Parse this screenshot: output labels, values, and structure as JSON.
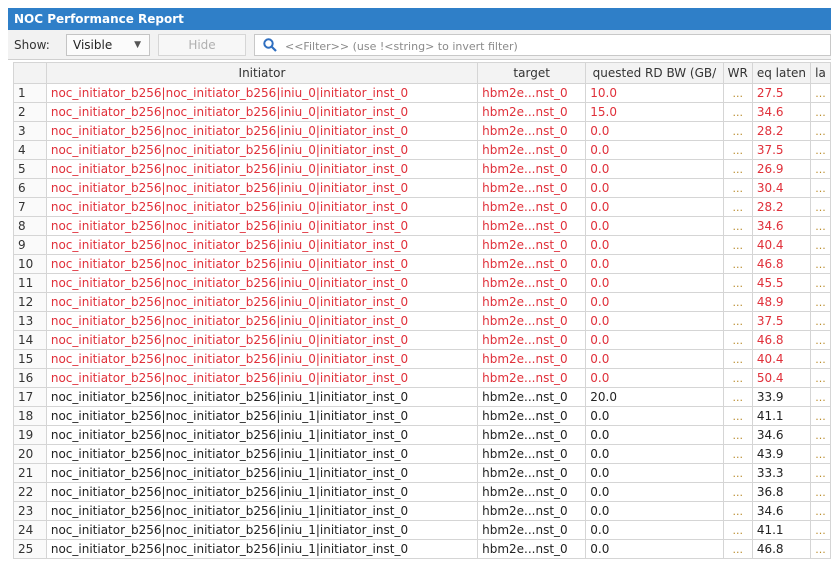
{
  "window": {
    "title": "NOC Performance Report"
  },
  "toolbar": {
    "show_label": "Show:",
    "show_value": "Visible",
    "hide_label": "Hide",
    "filter_placeholder": "<<Filter>> (use !<string> to invert filter)"
  },
  "table": {
    "columns": [
      "",
      "Initiator",
      "target",
      "quested RD BW (GB/",
      "WR",
      "eq laten",
      "la"
    ],
    "rows": [
      {
        "n": "1",
        "initiator": "noc_initiator_b256|noc_initiator_b256|iniu_0|initiator_inst_0",
        "target": "hbm2e...nst_0",
        "rd_bw": "10.0",
        "wr": "...",
        "lat": "27.5",
        "la": "...",
        "highlight": true
      },
      {
        "n": "2",
        "initiator": "noc_initiator_b256|noc_initiator_b256|iniu_0|initiator_inst_0",
        "target": "hbm2e...nst_0",
        "rd_bw": "15.0",
        "wr": "...",
        "lat": "34.6",
        "la": "...",
        "highlight": true
      },
      {
        "n": "3",
        "initiator": "noc_initiator_b256|noc_initiator_b256|iniu_0|initiator_inst_0",
        "target": "hbm2e...nst_0",
        "rd_bw": "0.0",
        "wr": "...",
        "lat": "28.2",
        "la": "...",
        "highlight": true
      },
      {
        "n": "4",
        "initiator": "noc_initiator_b256|noc_initiator_b256|iniu_0|initiator_inst_0",
        "target": "hbm2e...nst_0",
        "rd_bw": "0.0",
        "wr": "...",
        "lat": "37.5",
        "la": "...",
        "highlight": true
      },
      {
        "n": "5",
        "initiator": "noc_initiator_b256|noc_initiator_b256|iniu_0|initiator_inst_0",
        "target": "hbm2e...nst_0",
        "rd_bw": "0.0",
        "wr": "...",
        "lat": "26.9",
        "la": "...",
        "highlight": true
      },
      {
        "n": "6",
        "initiator": "noc_initiator_b256|noc_initiator_b256|iniu_0|initiator_inst_0",
        "target": "hbm2e...nst_0",
        "rd_bw": "0.0",
        "wr": "...",
        "lat": "30.4",
        "la": "...",
        "highlight": true
      },
      {
        "n": "7",
        "initiator": "noc_initiator_b256|noc_initiator_b256|iniu_0|initiator_inst_0",
        "target": "hbm2e...nst_0",
        "rd_bw": "0.0",
        "wr": "...",
        "lat": "28.2",
        "la": "...",
        "highlight": true
      },
      {
        "n": "8",
        "initiator": "noc_initiator_b256|noc_initiator_b256|iniu_0|initiator_inst_0",
        "target": "hbm2e...nst_0",
        "rd_bw": "0.0",
        "wr": "...",
        "lat": "34.6",
        "la": "...",
        "highlight": true
      },
      {
        "n": "9",
        "initiator": "noc_initiator_b256|noc_initiator_b256|iniu_0|initiator_inst_0",
        "target": "hbm2e...nst_0",
        "rd_bw": "0.0",
        "wr": "...",
        "lat": "40.4",
        "la": "...",
        "highlight": true
      },
      {
        "n": "10",
        "initiator": "noc_initiator_b256|noc_initiator_b256|iniu_0|initiator_inst_0",
        "target": "hbm2e...nst_0",
        "rd_bw": "0.0",
        "wr": "...",
        "lat": "46.8",
        "la": "...",
        "highlight": true
      },
      {
        "n": "11",
        "initiator": "noc_initiator_b256|noc_initiator_b256|iniu_0|initiator_inst_0",
        "target": "hbm2e...nst_0",
        "rd_bw": "0.0",
        "wr": "...",
        "lat": "45.5",
        "la": "...",
        "highlight": true
      },
      {
        "n": "12",
        "initiator": "noc_initiator_b256|noc_initiator_b256|iniu_0|initiator_inst_0",
        "target": "hbm2e...nst_0",
        "rd_bw": "0.0",
        "wr": "...",
        "lat": "48.9",
        "la": "...",
        "highlight": true
      },
      {
        "n": "13",
        "initiator": "noc_initiator_b256|noc_initiator_b256|iniu_0|initiator_inst_0",
        "target": "hbm2e...nst_0",
        "rd_bw": "0.0",
        "wr": "...",
        "lat": "37.5",
        "la": "...",
        "highlight": true
      },
      {
        "n": "14",
        "initiator": "noc_initiator_b256|noc_initiator_b256|iniu_0|initiator_inst_0",
        "target": "hbm2e...nst_0",
        "rd_bw": "0.0",
        "wr": "...",
        "lat": "46.8",
        "la": "...",
        "highlight": true
      },
      {
        "n": "15",
        "initiator": "noc_initiator_b256|noc_initiator_b256|iniu_0|initiator_inst_0",
        "target": "hbm2e...nst_0",
        "rd_bw": "0.0",
        "wr": "...",
        "lat": "40.4",
        "la": "...",
        "highlight": true
      },
      {
        "n": "16",
        "initiator": "noc_initiator_b256|noc_initiator_b256|iniu_0|initiator_inst_0",
        "target": "hbm2e...nst_0",
        "rd_bw": "0.0",
        "wr": "...",
        "lat": "50.4",
        "la": "...",
        "highlight": true
      },
      {
        "n": "17",
        "initiator": "noc_initiator_b256|noc_initiator_b256|iniu_1|initiator_inst_0",
        "target": "hbm2e...nst_0",
        "rd_bw": "20.0",
        "wr": "...",
        "lat": "33.9",
        "la": "...",
        "highlight": false
      },
      {
        "n": "18",
        "initiator": "noc_initiator_b256|noc_initiator_b256|iniu_1|initiator_inst_0",
        "target": "hbm2e...nst_0",
        "rd_bw": "0.0",
        "wr": "...",
        "lat": "41.1",
        "la": "...",
        "highlight": false
      },
      {
        "n": "19",
        "initiator": "noc_initiator_b256|noc_initiator_b256|iniu_1|initiator_inst_0",
        "target": "hbm2e...nst_0",
        "rd_bw": "0.0",
        "wr": "...",
        "lat": "34.6",
        "la": "...",
        "highlight": false
      },
      {
        "n": "20",
        "initiator": "noc_initiator_b256|noc_initiator_b256|iniu_1|initiator_inst_0",
        "target": "hbm2e...nst_0",
        "rd_bw": "0.0",
        "wr": "...",
        "lat": "43.9",
        "la": "...",
        "highlight": false
      },
      {
        "n": "21",
        "initiator": "noc_initiator_b256|noc_initiator_b256|iniu_1|initiator_inst_0",
        "target": "hbm2e...nst_0",
        "rd_bw": "0.0",
        "wr": "...",
        "lat": "33.3",
        "la": "...",
        "highlight": false
      },
      {
        "n": "22",
        "initiator": "noc_initiator_b256|noc_initiator_b256|iniu_1|initiator_inst_0",
        "target": "hbm2e...nst_0",
        "rd_bw": "0.0",
        "wr": "...",
        "lat": "36.8",
        "la": "...",
        "highlight": false
      },
      {
        "n": "23",
        "initiator": "noc_initiator_b256|noc_initiator_b256|iniu_1|initiator_inst_0",
        "target": "hbm2e...nst_0",
        "rd_bw": "0.0",
        "wr": "...",
        "lat": "34.6",
        "la": "...",
        "highlight": false
      },
      {
        "n": "24",
        "initiator": "noc_initiator_b256|noc_initiator_b256|iniu_1|initiator_inst_0",
        "target": "hbm2e...nst_0",
        "rd_bw": "0.0",
        "wr": "...",
        "lat": "41.1",
        "la": "...",
        "highlight": false
      },
      {
        "n": "25",
        "initiator": "noc_initiator_b256|noc_initiator_b256|iniu_1|initiator_inst_0",
        "target": "hbm2e...nst_0",
        "rd_bw": "0.0",
        "wr": "...",
        "lat": "46.8",
        "la": "...",
        "highlight": false
      }
    ]
  },
  "colors": {
    "title_bar": "#2f7fc8",
    "highlight_text": "#e0303a"
  }
}
